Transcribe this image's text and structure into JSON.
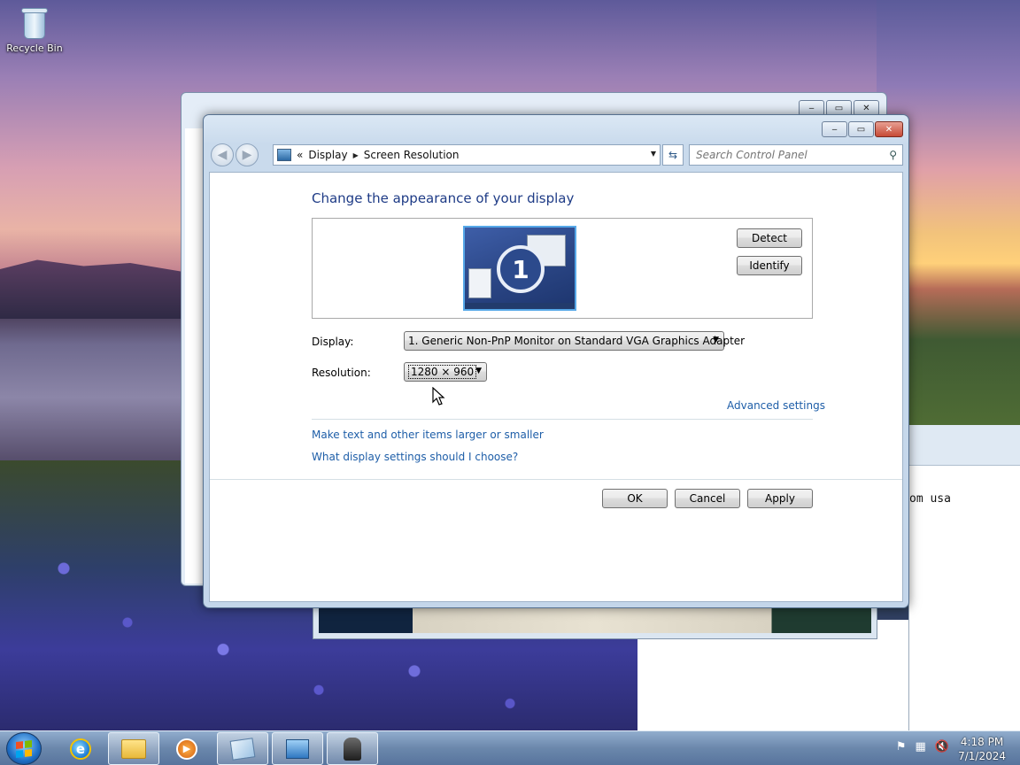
{
  "desktop": {
    "recycle_bin_label": "Recycle Bin"
  },
  "background_terminal": {
    "visible_text": "om usa"
  },
  "window": {
    "controls": {
      "minimize": "‒",
      "maximize": "▭",
      "close": "✕"
    },
    "breadcrumb": {
      "prefix": "«",
      "items": [
        "Display",
        "Screen Resolution"
      ]
    },
    "search": {
      "placeholder": "Search Control Panel"
    }
  },
  "content": {
    "heading": "Change the appearance of your display",
    "monitor_number": "1",
    "detect_label": "Detect",
    "identify_label": "Identify",
    "display_label": "Display:",
    "display_value": "1. Generic Non-PnP Monitor on Standard VGA Graphics Adapter",
    "resolution_label": "Resolution:",
    "resolution_value": "1280 × 960",
    "advanced_link": "Advanced settings",
    "link_text_size": "Make text and other items larger or smaller",
    "link_which_settings": "What display settings should I choose?",
    "ok_label": "OK",
    "cancel_label": "Cancel",
    "apply_label": "Apply"
  },
  "taskbar": {
    "apps": [
      "internet-explorer",
      "windows-explorer",
      "media-player",
      "paint",
      "control-panel",
      "chess"
    ],
    "clock_time": "4:18 PM",
    "clock_date": "7/1/2024"
  },
  "colors": {
    "heading": "#1e3b86",
    "link": "#1e5ea8"
  }
}
